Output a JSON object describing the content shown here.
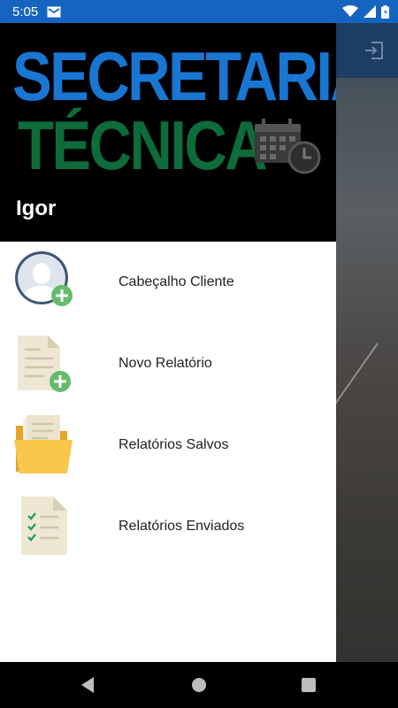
{
  "status_bar": {
    "time": "5:05",
    "icons": [
      "mail-icon",
      "wifi-icon",
      "signal-icon",
      "battery-icon"
    ]
  },
  "drawer": {
    "logo_line1": "SECRETARIA",
    "logo_line2": "TÉCNICA",
    "user_name": "Igor",
    "items": [
      {
        "label": "Cabeçalho Cliente",
        "icon": "add-client-icon"
      },
      {
        "label": "Novo Relatório",
        "icon": "new-report-icon"
      },
      {
        "label": "Relatórios Salvos",
        "icon": "saved-reports-folder-icon"
      },
      {
        "label": "Relatórios Enviados",
        "icon": "sent-reports-checklist-icon"
      }
    ]
  },
  "colors": {
    "status_bar": "#1565c0",
    "logo_blue": "#1976d2",
    "logo_green": "#0e6b3a",
    "header_bg": "#000000",
    "add_badge": "#66bb6a"
  },
  "nav_bar": {
    "icons": [
      "back-icon",
      "home-icon",
      "recents-icon"
    ]
  }
}
